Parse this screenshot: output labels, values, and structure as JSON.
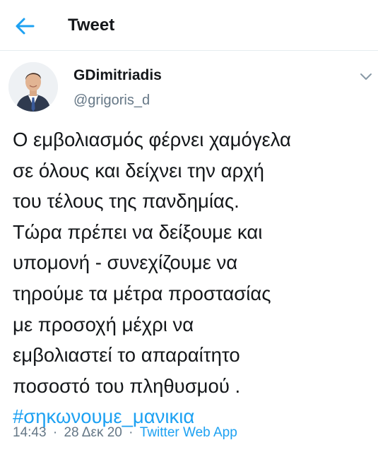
{
  "header": {
    "title": "Tweet",
    "back_icon": "arrow-left-icon"
  },
  "author": {
    "display_name": "GDimitriadis",
    "handle": "@grigoris_d",
    "menu_icon": "chevron-down-icon"
  },
  "tweet": {
    "lines": [
      "Ο εμβολιασμός φέρνει χαμόγελα",
      "σε όλους και δείχνει την αρχή",
      "του τέλους της πανδημίας.",
      "Τώρα πρέπει να δείξουμε και",
      "υπομονή - συνεχίζουμε να",
      "τηρούμε τα μέτρα προστασίας",
      "με προσοχή μέχρι να",
      "εμβολιαστεί το απαραίτητο",
      "ποσοστό του πληθυσμού ."
    ],
    "hashtag": "#σηκωνουμε_μανικια"
  },
  "meta": {
    "time": "14:43",
    "separator": "·",
    "date": "28 Δεκ 20",
    "source": "Twitter Web App"
  },
  "colors": {
    "accent": "#1da1f2",
    "secondary_text": "#657786",
    "primary_text": "#14171a",
    "divider": "#e6ecf0"
  }
}
